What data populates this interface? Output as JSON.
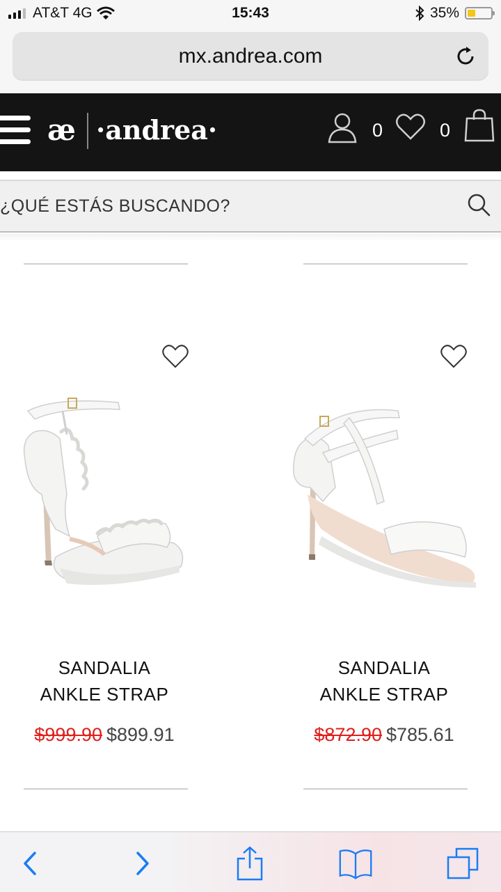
{
  "status_bar": {
    "carrier": "AT&T 4G",
    "time": "15:43",
    "battery_percent": "35%",
    "battery_level": 0.35,
    "icons": [
      "signal-icon",
      "wifi-icon",
      "bluetooth-icon",
      "battery-icon"
    ]
  },
  "browser": {
    "url": "mx.andrea.com",
    "icons": [
      "reload-icon"
    ]
  },
  "header": {
    "logo_mark": "æ",
    "logo_text": "·andrea·",
    "account_count": "0",
    "wishlist_count": "0",
    "icons": [
      "menu-icon",
      "user-icon",
      "heart-icon",
      "shopping-bag-icon"
    ]
  },
  "search": {
    "placeholder": "¿QUÉ ESTÁS BUSCANDO?",
    "icon": "search-icon"
  },
  "products": [
    {
      "name_line1": "SANDALIA",
      "name_line2": "ANKLE STRAP",
      "old_price": "$999.90",
      "new_price": "$899.91",
      "image": "white-platform-ruffle-sandal"
    },
    {
      "name_line1": "SANDALIA",
      "name_line2": "ANKLE STRAP",
      "old_price": "$872.90",
      "new_price": "$785.61",
      "image": "white-strappy-heel-sandal"
    }
  ],
  "toolbar": {
    "icons": [
      "back-icon",
      "forward-icon",
      "share-icon",
      "bookmarks-icon",
      "tabs-icon"
    ]
  },
  "colors": {
    "header_bg": "#141414",
    "sale_red": "#e0201c",
    "ios_blue": "#1a7cf5"
  }
}
